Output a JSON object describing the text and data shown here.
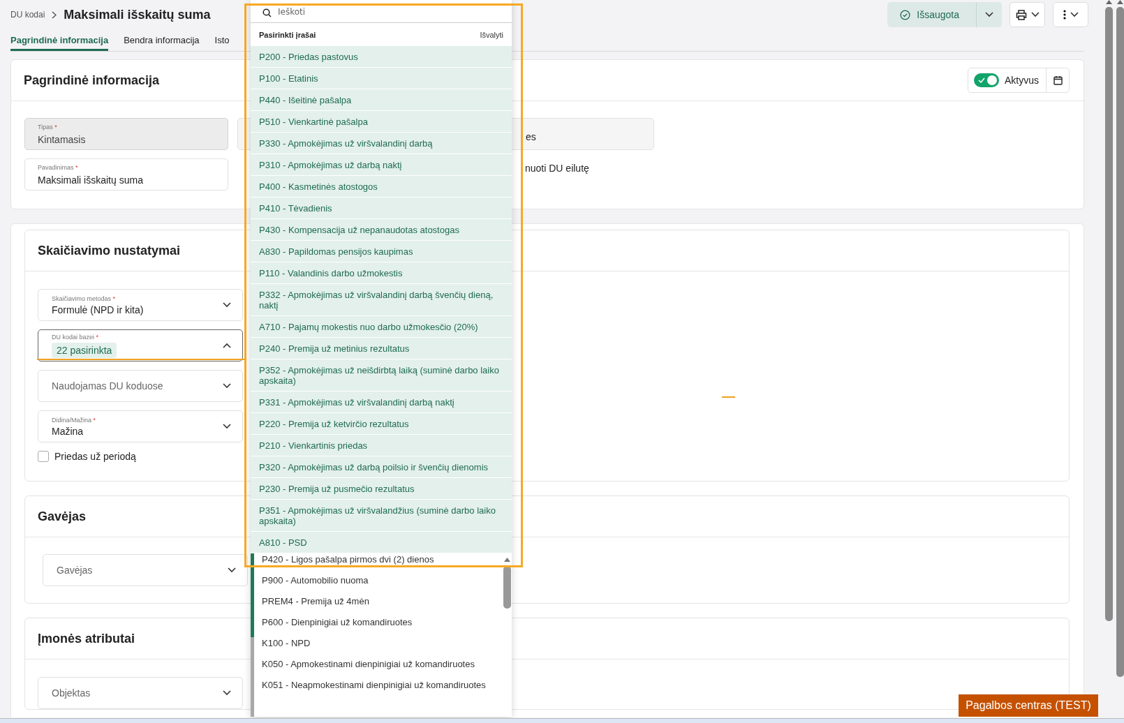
{
  "breadcrumb": {
    "parent": "DU kodai",
    "current": "Maksimali išskaitų suma"
  },
  "header_actions": {
    "save_status": "Išsaugota"
  },
  "tabs": [
    {
      "label": "Pagrindinė informacija",
      "selected": true
    },
    {
      "label": "Bendra informacija",
      "selected": false
    },
    {
      "label": "Isto",
      "selected": false
    }
  ],
  "basic_info": {
    "title": "Pagrindinė informacija",
    "active_toggle": {
      "label": "Aktyvus",
      "on": true
    },
    "fields": [
      {
        "label": "Tipas",
        "required_mark": "*",
        "value": "Kintamasis",
        "disabled": true
      },
      {
        "label": "Pavadinimas",
        "required_mark": "*",
        "value": "Maksimali išskaitų suma",
        "disabled": false
      }
    ],
    "partial_field_value": "es",
    "partial_checkbox_label": "nuoti DU eilutę"
  },
  "calculation": {
    "title": "Skaičiavimo nustatymai",
    "fields": [
      {
        "label": "Skaičiavimo metodas",
        "required_mark": "*",
        "value": "Formulė (NPD ir kita)",
        "expanded": false
      },
      {
        "label": "DU kodai bazei",
        "required_mark": "*",
        "chip": "22 pasirinkta",
        "expanded": true
      },
      {
        "placeholder": "Naudojamas DU koduose",
        "expanded": false
      },
      {
        "label": "Didina/Mažina",
        "required_mark": "*",
        "value": "Mažina",
        "expanded": false
      }
    ],
    "checkbox": {
      "label": "Priedas už periodą",
      "checked": false
    }
  },
  "recipient": {
    "title": "Gavėjas",
    "fields": [
      {
        "placeholder": "Gavėjas",
        "expanded": false
      }
    ]
  },
  "company_attributes": {
    "title": "Įmonės atributai",
    "fields": [
      {
        "placeholder": "Objektas",
        "expanded": false
      }
    ]
  },
  "dropdown": {
    "search_placeholder": "Ieškoti",
    "selected_header": "Pasirinkti įrašai",
    "clear_label": "Išvalyti",
    "options": [
      {
        "label": "P200 - Priedas pastovus",
        "selected": true
      },
      {
        "label": "P100 - Etatinis",
        "selected": true
      },
      {
        "label": "P440 - Išeitinė pašalpa",
        "selected": true
      },
      {
        "label": "P510 - Vienkartinė pašalpa",
        "selected": true
      },
      {
        "label": "P330 - Apmokėjimas už viršvalandinį darbą",
        "selected": true
      },
      {
        "label": "P310 - Apmokėjimas už darbą naktį",
        "selected": true
      },
      {
        "label": "P400 - Kasmetinės atostogos",
        "selected": true
      },
      {
        "label": "P410 - Tėvadienis",
        "selected": true
      },
      {
        "label": "P430 - Kompensacija už nepanaudotas atostogas",
        "selected": true
      },
      {
        "label": "A830 - Papildomas pensijos kaupimas",
        "selected": true
      },
      {
        "label": "P110 - Valandinis darbo užmokestis",
        "selected": true
      },
      {
        "label": "P332 - Apmokėjimas už viršvalandinį darbą švenčių dieną, naktį",
        "selected": true
      },
      {
        "label": "A710 - Pajamų mokestis nuo darbo užmokesčio (20%)",
        "selected": true
      },
      {
        "label": "P240 - Premija už metinius rezultatus",
        "selected": true
      },
      {
        "label": "P352 - Apmokėjimas už neišdirbtą laiką (suminė darbo laiko apskaita)",
        "selected": true
      },
      {
        "label": "P331 - Apmokėjimas už viršvalandinį darbą naktį",
        "selected": true
      },
      {
        "label": "P220 - Premija už ketvirčio rezultatus",
        "selected": true
      },
      {
        "label": "P210 - Vienkartinis priedas",
        "selected": true
      },
      {
        "label": "P320 - Apmokėjimas už darbą poilsio ir švenčių dienomis",
        "selected": true
      },
      {
        "label": "P230 - Premija už pusmečio rezultatus",
        "selected": true
      },
      {
        "label": "P351 - Apmokėjimas už viršvalandžius (suminė darbo laiko apskaita)",
        "selected": true
      },
      {
        "label": "A810 - PSD",
        "selected": true
      },
      {
        "label": "P420 - Ligos pašalpa pirmos dvi (2) dienos",
        "selected": false
      },
      {
        "label": "P900 - Automobilio nuoma",
        "selected": false
      },
      {
        "label": "PREM4 - Premija už 4mėn",
        "selected": false
      },
      {
        "label": "P600 - Dienpinigiai už komandiruotes",
        "selected": false
      },
      {
        "label": "K100 - NPD",
        "selected": false
      },
      {
        "label": "K050 - Apmokestinami dienpinigiai už komandiruotes",
        "selected": false
      },
      {
        "label": "K051 - Neapmokestinami dienpinigiai už komandiruotes",
        "selected": false
      }
    ]
  },
  "help_button": "Pagalbos centras (TEST)"
}
